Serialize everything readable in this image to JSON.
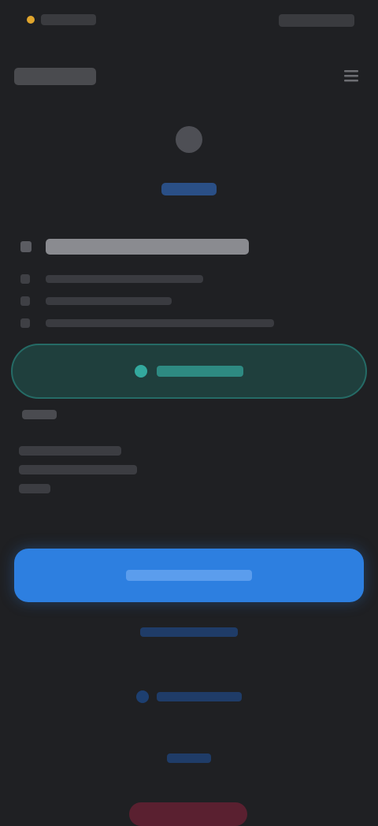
{
  "status_bar": {},
  "app_bar": {},
  "hero": {},
  "headline": {},
  "details": {},
  "teal_action": {},
  "section": {},
  "primary_action": {},
  "secondary_links": {},
  "danger_action": {},
  "colors": {
    "background": "#1f2023",
    "accent_blue": "#2d7fe0",
    "accent_teal": "#256b66",
    "accent_red": "#5a2030",
    "status_amber": "#e0a52d"
  },
  "icons": {
    "menu": "menu-icon",
    "avatar": "avatar",
    "teal_action_icon": "check-circle-icon",
    "secondary_link_icon": "link-icon"
  }
}
